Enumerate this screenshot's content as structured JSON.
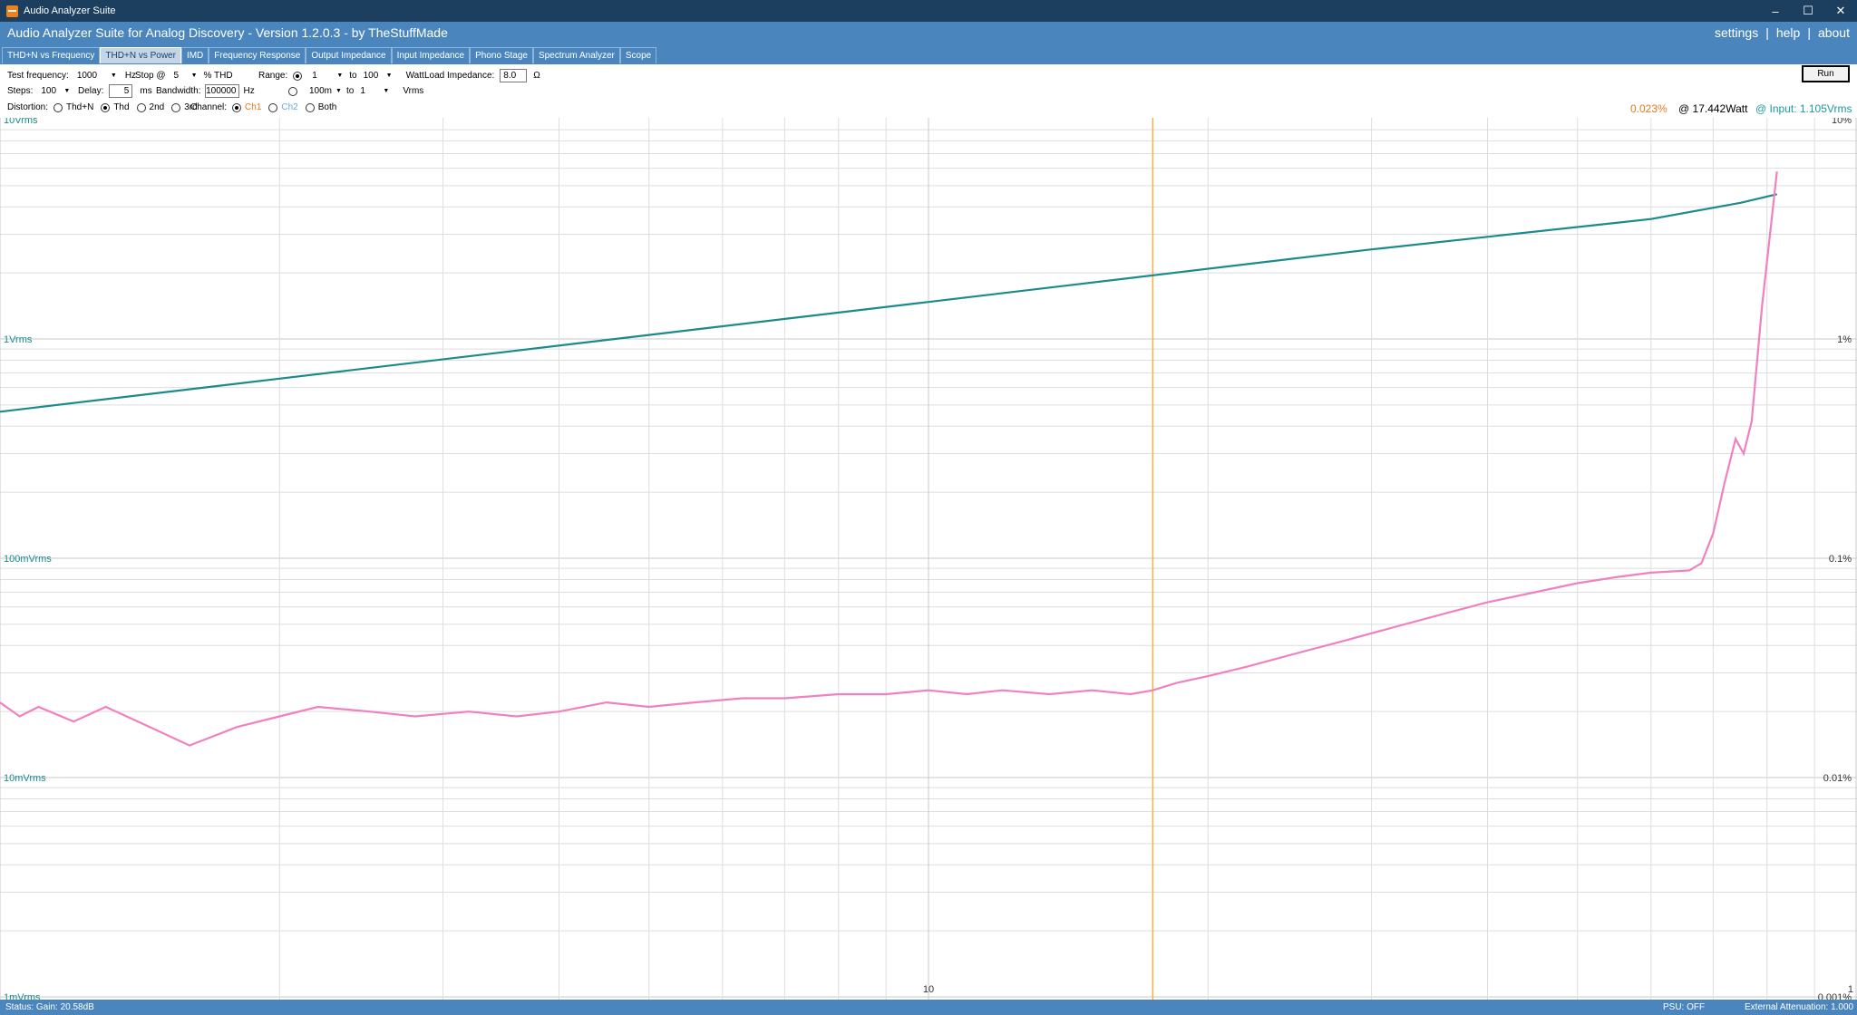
{
  "window": {
    "title": "Audio Analyzer Suite",
    "controls": {
      "minimize": "–",
      "maximize": "☐",
      "close": "✕"
    }
  },
  "header": {
    "app_title": "Audio Analyzer Suite for Analog Discovery - Version   1.2.0.3   - by TheStuffMade",
    "links": {
      "settings": "settings",
      "help": "help",
      "about": "about",
      "separator": "|"
    }
  },
  "tabs": [
    {
      "label": "THD+N vs Frequency",
      "active": false
    },
    {
      "label": "THD+N vs Power",
      "active": true
    },
    {
      "label": "IMD",
      "active": false
    },
    {
      "label": "Frequency Response",
      "active": false
    },
    {
      "label": "Output Impedance",
      "active": false
    },
    {
      "label": "Input Impedance",
      "active": false
    },
    {
      "label": "Phono Stage",
      "active": false
    },
    {
      "label": "Spectrum Analyzer",
      "active": false
    },
    {
      "label": "Scope",
      "active": false
    }
  ],
  "controls": {
    "test_frequency": {
      "label": "Test frequency:",
      "value": "1000",
      "unit": "Hz"
    },
    "stop": {
      "label": "Stop @",
      "value": "5",
      "unit": "% THD"
    },
    "range": {
      "label": "Range:",
      "from_watt": "1",
      "to_label": "to",
      "to_watt": "100",
      "watt_unit": "Watt",
      "from_vrms": "100m",
      "to_vrms": "1",
      "vrms_unit": "Vrms",
      "watt_selected": true
    },
    "load_impedance": {
      "label": "Load Impedance:",
      "value": "8.0",
      "unit": "Ω"
    },
    "steps": {
      "label": "Steps:",
      "value": "100"
    },
    "delay": {
      "label": "Delay:",
      "value": "5",
      "unit": "ms"
    },
    "bandwidth": {
      "label": "Bandwidth:",
      "value": "100000",
      "unit": "Hz"
    },
    "distortion": {
      "label": "Distortion:",
      "options": [
        "Thd+N",
        "Thd",
        "2nd",
        "3rd"
      ],
      "selected": "Thd"
    },
    "channel": {
      "label": "Channel:",
      "options": [
        "Ch1",
        "Ch2",
        "Both"
      ],
      "selected": "Ch1"
    },
    "run_label": "Run"
  },
  "readout": {
    "thd": "0.023%",
    "power": "@ 17.442Watt",
    "input": "@ Input: 1.105Vrms"
  },
  "colors": {
    "titlebar": "#1d3f5f",
    "header": "#4a86bd",
    "thd_curve": "#f080c0",
    "voltage_curve": "#1a8a8a",
    "cursor": "#f5b041",
    "readout_thd": "#e8781e",
    "readout_input": "#1a9a9a",
    "ch1": "#e8781e",
    "ch2": "#6aa8d8"
  },
  "chart_data": {
    "type": "line",
    "x_scale": "log",
    "xlim": [
      1,
      100
    ],
    "x_tick_labels": [
      "10",
      "1"
    ],
    "left_axis": {
      "scale": "log",
      "labels": [
        "10Vrms",
        "1Vrms",
        "100mVrms",
        "10mVrms",
        "1mVrms"
      ]
    },
    "right_axis": {
      "scale": "log",
      "labels": [
        "10%",
        "1%",
        "0.1%",
        "0.01%",
        "0.001%"
      ]
    },
    "cursor_x": 17.442,
    "grid": true,
    "series": [
      {
        "axis": "left",
        "x": [
          1,
          2,
          5,
          10,
          17.442,
          30,
          60,
          75,
          82
        ],
        "y": [
          0.466,
          0.659,
          1.043,
          1.474,
          1.95,
          2.56,
          3.52,
          4.18,
          4.57
        ]
      },
      {
        "axis": "right",
        "x": [
          1,
          1.05,
          1.1,
          1.2,
          1.3,
          1.45,
          1.6,
          1.8,
          2.0,
          2.2,
          2.5,
          2.8,
          3.2,
          3.6,
          4.0,
          4.5,
          5.0,
          5.6,
          6.3,
          7.0,
          8.0,
          9.0,
          10,
          11,
          12,
          13.5,
          15,
          16.5,
          17.442,
          18.5,
          20,
          22,
          25,
          28,
          32,
          36,
          40,
          45,
          50,
          55,
          60,
          63,
          66,
          68,
          70,
          72,
          74,
          75.5,
          77,
          79,
          82
        ],
        "y": [
          0.022,
          0.019,
          0.021,
          0.018,
          0.021,
          0.017,
          0.014,
          0.017,
          0.019,
          0.021,
          0.02,
          0.019,
          0.02,
          0.019,
          0.02,
          0.022,
          0.021,
          0.022,
          0.023,
          0.023,
          0.024,
          0.024,
          0.025,
          0.024,
          0.025,
          0.024,
          0.025,
          0.024,
          0.025,
          0.027,
          0.029,
          0.032,
          0.037,
          0.042,
          0.049,
          0.056,
          0.063,
          0.07,
          0.077,
          0.082,
          0.086,
          0.087,
          0.088,
          0.095,
          0.13,
          0.22,
          0.35,
          0.3,
          0.42,
          1.4,
          5.8
        ]
      }
    ]
  },
  "status": {
    "left": "Status: Gain: 20.58dB",
    "psu": "PSU: OFF",
    "attenuation": "External Attenuation: 1.000"
  }
}
